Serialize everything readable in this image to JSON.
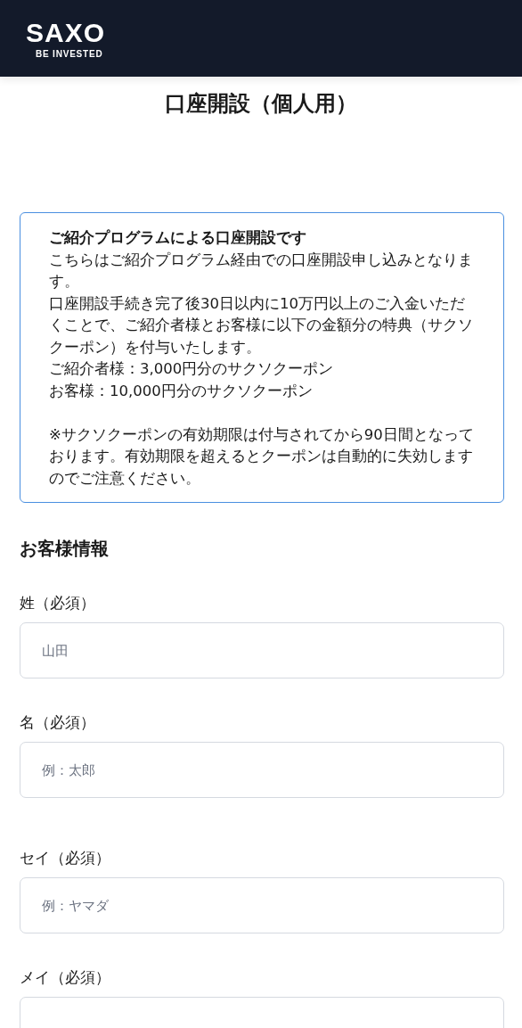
{
  "header": {
    "logo": "SAXO",
    "tagline": "BE INVESTED"
  },
  "title": "口座開設（個人用）",
  "notice": {
    "heading": "ご紹介プログラムによる口座開設です",
    "paragraphs": [
      "こちらはご紹介プログラム経由での口座開設申し込みとなります。",
      "口座開設手続き完了後30日以内に10万円以上のご入金いただくことで、ご紹介者様とお客様に以下の金額分の特典（サクソクーポン）を付与いたします。",
      "ご紹介者様：3,000円分のサクソクーポン",
      "お客様：10,000円分のサクソクーポン"
    ],
    "note": "※サクソクーポンの有効期限は付与されてから90日間となっております。有効期限を超えるとクーポンは自動的に失効しますのでご注意ください。"
  },
  "section_title": "お客様情報",
  "fields": [
    {
      "label": "姓（必須）",
      "placeholder": "山田"
    },
    {
      "label": "名（必須）",
      "placeholder": "例：太郎"
    },
    {
      "label": "セイ（必須）",
      "placeholder": "例：ヤマダ"
    },
    {
      "label": "メイ（必須）"
    }
  ]
}
